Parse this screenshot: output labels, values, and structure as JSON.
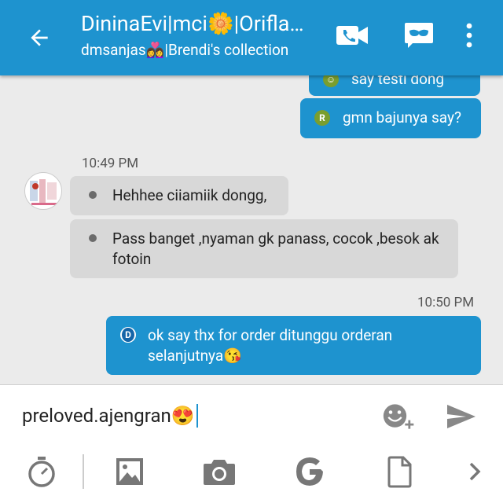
{
  "header": {
    "title": "DininaEvi|mci🌼|Oriflame",
    "subtitle": "dmsanjas👩‍❤️‍👩|Brendi's collection"
  },
  "messages": {
    "partial": {
      "text": "say testi dong"
    },
    "out1": {
      "badge": "R",
      "text": "gmn bajunya say?"
    },
    "time1": "10:49 PM",
    "in1": {
      "text": "Hehhee ciiamiik dongg,"
    },
    "in2": {
      "text": "Pass banget ,nyaman gk panass, cocok ,besok ak fotoin"
    },
    "time2": "10:50 PM",
    "out2": {
      "badge": "D",
      "text": "ok say thx for order ditunggu orderan selanjutnya😘"
    }
  },
  "compose": {
    "input_value": "preloved.ajengran😍"
  },
  "colors": {
    "accent": "#1e93cf",
    "incoming_bubble": "#d8d8d8",
    "badge_r": "#7a9e2e",
    "badge_d": "#1565a8"
  },
  "icons": {
    "back": "arrow-left-icon",
    "video": "video-call-icon",
    "mask": "mask-icon",
    "more": "more-vert-icon",
    "emoji": "emoji-add-icon",
    "send": "send-icon",
    "timer": "timer-icon",
    "image": "image-icon",
    "camera": "camera-icon",
    "refresh": "google-g-icon",
    "file": "file-icon",
    "chevron": "chevron-right-icon"
  }
}
